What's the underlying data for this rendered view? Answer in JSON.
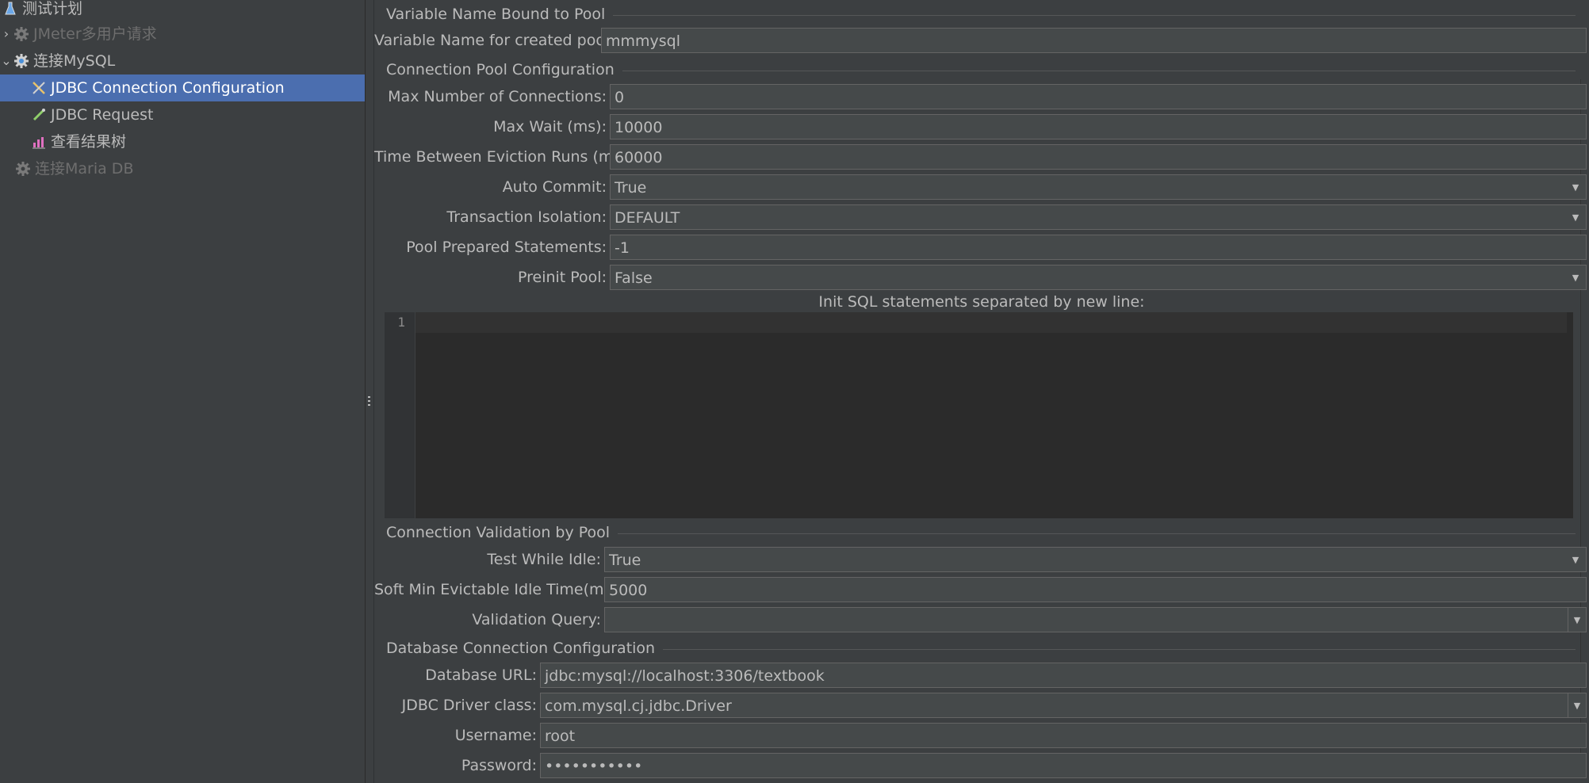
{
  "tree": {
    "items": [
      {
        "label": "测试计划",
        "icon": "flask-icon"
      },
      {
        "label": "JMeter多用户请求",
        "icon": "gear-icon",
        "disabled": true
      },
      {
        "label": "连接MySQL",
        "icon": "gear-icon"
      },
      {
        "label": "JDBC Connection Configuration",
        "icon": "wrench-icon",
        "selected": true
      },
      {
        "label": "JDBC Request",
        "icon": "pipette-icon"
      },
      {
        "label": "查看结果树",
        "icon": "chart-icon"
      },
      {
        "label": "连接Maria DB",
        "icon": "gear-icon",
        "disabled": true
      }
    ]
  },
  "sections": {
    "bound": "Variable Name Bound to Pool",
    "pool": "Connection Pool Configuration",
    "validation": "Connection Validation by Pool",
    "database": "Database Connection Configuration"
  },
  "fields": {
    "pool_var_label": "Variable Name for created pool:",
    "pool_var_value": "mmmysql",
    "max_conn_label": "Max Number of Connections:",
    "max_conn_value": "0",
    "max_wait_label": "Max Wait (ms):",
    "max_wait_value": "10000",
    "eviction_label": "Time Between Eviction Runs (ms):",
    "eviction_value": "60000",
    "auto_commit_label": "Auto Commit:",
    "auto_commit_value": "True",
    "isolation_label": "Transaction Isolation:",
    "isolation_value": "DEFAULT",
    "prepared_label": "Pool Prepared Statements:",
    "prepared_value": "-1",
    "preinit_label": "Preinit Pool:",
    "preinit_value": "False",
    "init_sql_caption": "Init SQL statements separated by new line:",
    "init_sql_lineno": "1",
    "test_idle_label": "Test While Idle:",
    "test_idle_value": "True",
    "soft_min_label": "Soft Min Evictable Idle Time(ms):",
    "soft_min_value": "5000",
    "validation_query_label": "Validation Query:",
    "validation_query_value": "",
    "db_url_label": "Database URL:",
    "db_url_value": "jdbc:mysql://localhost:3306/textbook",
    "driver_label": "JDBC Driver class:",
    "driver_value": "com.mysql.cj.jdbc.Driver",
    "username_label": "Username:",
    "username_value": "root",
    "password_label": "Password:",
    "password_value": "•••••••••••"
  },
  "colors": {
    "background": "#3c3f41",
    "selection": "#4b6eaf",
    "field_bg": "#45494a",
    "editor_bg": "#2b2b2b"
  }
}
